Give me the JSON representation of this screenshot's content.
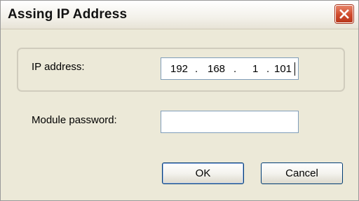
{
  "window": {
    "title": "Assing IP Address",
    "close_icon": "close-icon"
  },
  "form": {
    "ip_label": "IP address:",
    "ip_octets": [
      "192",
      "168",
      "1",
      "101"
    ],
    "ip_separator": ".",
    "password_label": "Module password:",
    "password_value": ""
  },
  "buttons": {
    "ok_label": "OK",
    "cancel_label": "Cancel"
  },
  "colors": {
    "dialog_bg": "#ece9d8",
    "close_red": "#cf4a2c",
    "field_border": "#7f9db9"
  }
}
